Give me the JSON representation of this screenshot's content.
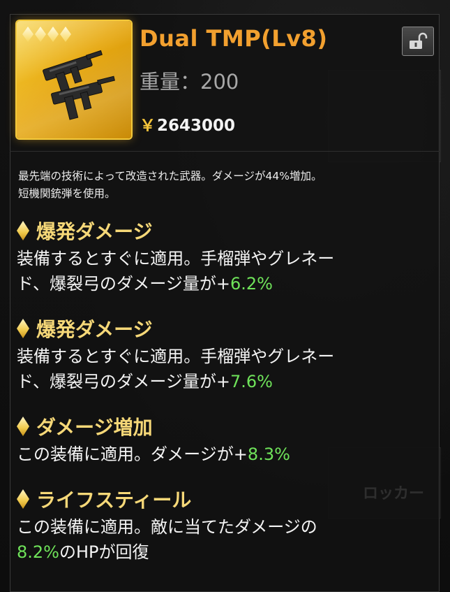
{
  "item": {
    "name": "Dual TMP(Lv8)",
    "weight_label": "重量：",
    "weight_value": "200",
    "price_symbol": "￥",
    "price": "2643000",
    "rarity_stars": 4,
    "icon": "dual-smg-icon",
    "lock_icon": "padlock-open-icon"
  },
  "description": {
    "line1": "最先端の技術によって改造された武器。ダメージが44%増加。",
    "line2": "短機関銃弾を使用。"
  },
  "effects": [
    {
      "title": "爆発ダメージ",
      "line1": "装備するとすぐに適用。手榴弾やグレネー",
      "line2_prefix": "ド、爆裂弓のダメージ量が+",
      "value": "6.2%",
      "line2_suffix": ""
    },
    {
      "title": "爆発ダメージ",
      "line1": "装備するとすぐに適用。手榴弾やグレネー",
      "line2_prefix": "ド、爆裂弓のダメージ量が+",
      "value": "7.6%",
      "line2_suffix": ""
    },
    {
      "title": "ダメージ増加",
      "line1_prefix": "この装備に適用。ダメージが+",
      "value": "8.3%"
    },
    {
      "title": "ライフスティール",
      "line1": "この装備に適用。敵に当てたダメージの",
      "value": "8.2%",
      "line2_suffix": "のHPが回復"
    }
  ],
  "colors": {
    "name": "#f2a02f",
    "effect_title": "#f6d878",
    "value_green": "#6fe35a",
    "rarity_gold": "#f3c93a"
  }
}
